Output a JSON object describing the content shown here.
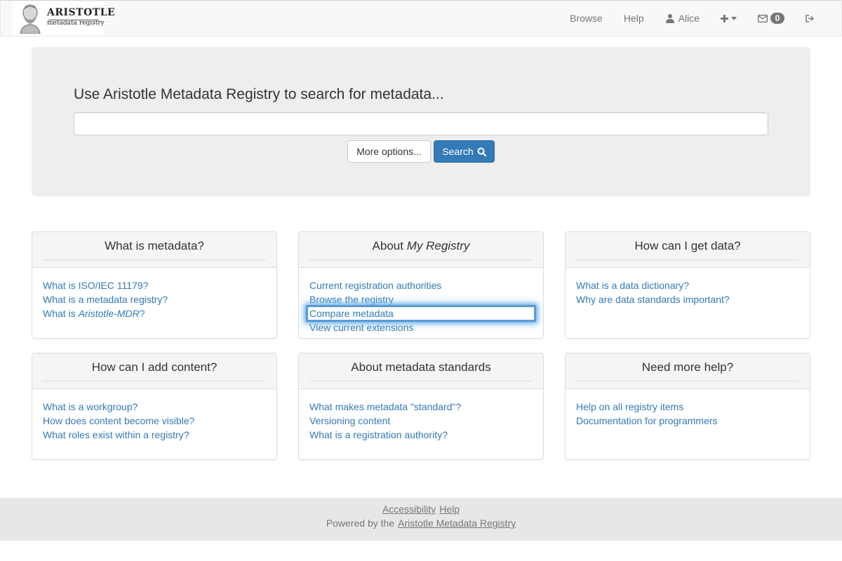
{
  "navbar": {
    "brand": {
      "name": "ARISTOTLE",
      "subtitle": "metadata registry",
      "logo_icon": "aristotle-bust-icon"
    },
    "links": {
      "browse": "Browse",
      "help": "Help",
      "user": "Alice",
      "user_icon": "user-icon",
      "create_icon": "plus-icon",
      "create_caret_icon": "caret-down-icon",
      "inbox_icon": "envelope-icon",
      "inbox_count": "0",
      "logout_icon": "sign-out-icon"
    }
  },
  "search": {
    "heading": "Use Aristotle Metadata Registry to search for metadata...",
    "input_value": "",
    "more_options_label": "More options...",
    "search_label": "Search",
    "search_icon": "search-icon"
  },
  "panels": [
    {
      "title": "What is metadata?",
      "links": [
        {
          "text": "What is ISO/IEC 11179?"
        },
        {
          "text": "What is a metadata registry?"
        },
        {
          "pre": "What is ",
          "em": "Aristotle-MDR",
          "post": "?"
        }
      ]
    },
    {
      "title_pre": "About ",
      "title_em": "My Registry",
      "links": [
        {
          "text": "Current registration authorities"
        },
        {
          "text": "Browse the registry"
        },
        {
          "text": "Compare metadata",
          "focused": true
        },
        {
          "text": "View current extensions"
        }
      ]
    },
    {
      "title": "How can I get data?",
      "links": [
        {
          "text": "What is a data dictionary?"
        },
        {
          "text": "Why are data standards important?"
        }
      ]
    },
    {
      "title": "How can I add content?",
      "links": [
        {
          "text": "What is a workgroup?"
        },
        {
          "text": "How does content become visible?"
        },
        {
          "text": "What roles exist within a registry?"
        }
      ]
    },
    {
      "title": "About metadata standards",
      "links": [
        {
          "text": "What makes metadata \"standard\"?"
        },
        {
          "text": "Versioning content"
        },
        {
          "text": "What is a registration authority?"
        }
      ]
    },
    {
      "title": "Need more help?",
      "links": [
        {
          "text": "Help on all registry items"
        },
        {
          "text": "Documentation for programmers"
        }
      ]
    }
  ],
  "footer": {
    "accessibility": "Accessibility",
    "help": "Help",
    "powered_by": "Powered by the",
    "powered_link": "Aristotle Metadata Registry"
  },
  "colors": {
    "link": "#337ab7",
    "primary": "#337ab7",
    "navbar_bg": "#f8f8f8",
    "jumbotron_bg": "#eeeeee",
    "footer_bg": "#e7e7e7",
    "focus_ring": "#66afe9"
  }
}
